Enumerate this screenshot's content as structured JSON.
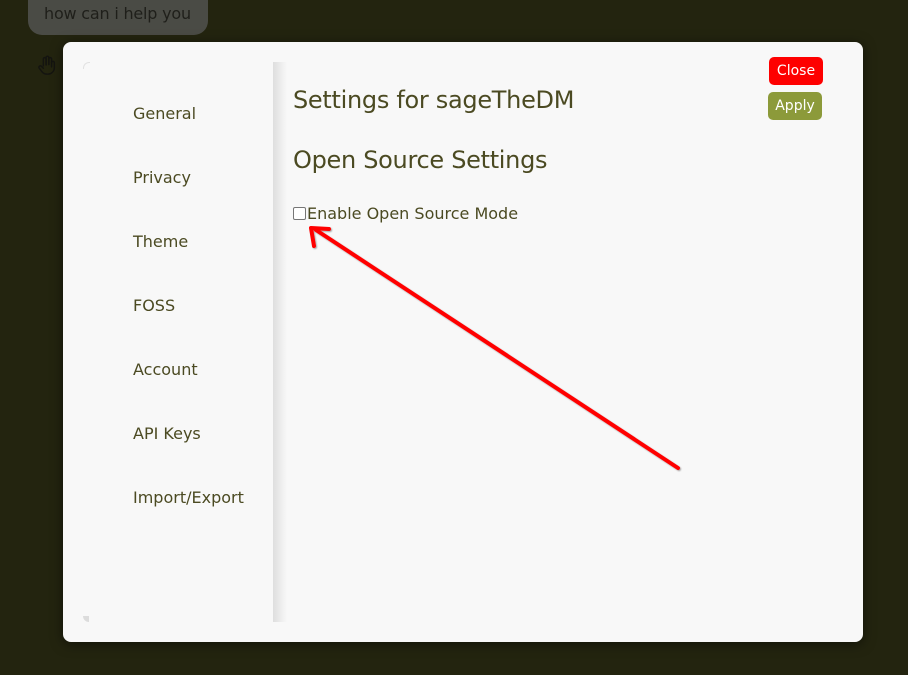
{
  "chat": {
    "message": "how can i help you"
  },
  "modal": {
    "title": "Settings for sageTheDM",
    "section_title": "Open Source Settings",
    "option_label": "Enable Open Source Mode",
    "option_checked": false,
    "close_label": "Close",
    "apply_label": "Apply"
  },
  "sidebar": {
    "items": [
      {
        "label": "General"
      },
      {
        "label": "Privacy"
      },
      {
        "label": "Theme"
      },
      {
        "label": "FOSS"
      },
      {
        "label": "Account"
      },
      {
        "label": "API Keys"
      },
      {
        "label": "Import/Export"
      }
    ]
  },
  "annotation": {
    "arrow_color": "#ff0000",
    "arrow_target": "enable-open-source-checkbox"
  },
  "colors": {
    "background": "#23240f",
    "modal": "#f8f8f8",
    "text": "#4b4a22",
    "close_button": "#fe0000",
    "apply_button": "#8c9a3a"
  }
}
